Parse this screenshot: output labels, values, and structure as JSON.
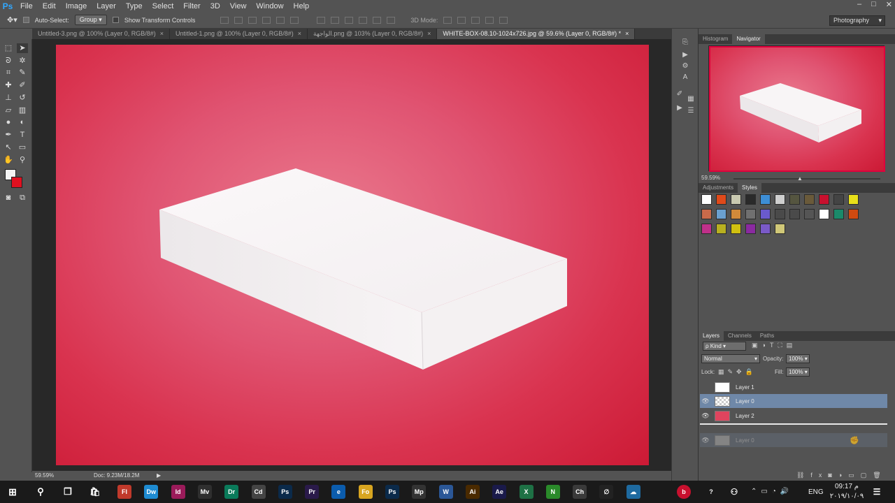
{
  "app": {
    "logo": "Ps"
  },
  "menu": [
    "File",
    "Edit",
    "Image",
    "Layer",
    "Type",
    "Select",
    "Filter",
    "3D",
    "View",
    "Window",
    "Help"
  ],
  "window_controls": [
    "–",
    "□",
    "✕"
  ],
  "options_bar": {
    "auto_select_label": "Auto-Select:",
    "auto_select_value": "Group",
    "show_transform_label": "Show Transform Controls",
    "mode_3d_label": "3D Mode:"
  },
  "workspace": "Photography",
  "tabs": [
    {
      "label": "Untitled-3.png @ 100% (Layer 0, RGB/8#)",
      "close": "×"
    },
    {
      "label": "Untitled-1.png @ 100% (Layer 0, RGB/8#)",
      "close": "×"
    },
    {
      "label": "الواجهة.png @ 103% (Layer 0, RGB/8#)",
      "close": "×"
    },
    {
      "label": "WHITE-BOX-08.10-1024x726.jpg @ 59.6% (Layer 0, RGB/8#) *",
      "close": "×"
    }
  ],
  "status": {
    "zoom": "59.59%",
    "doc": "Doc: 9.23M/18.2M"
  },
  "navigator": {
    "tabs": [
      "Histogram",
      "Navigator"
    ],
    "zoom": "59.59%"
  },
  "styles_panel": {
    "tabs": [
      "Adjustments",
      "Styles"
    ],
    "swatch_colors": [
      "#ffffff",
      "#e04a1a",
      "#c9c9b0",
      "#2a2a2a",
      "#3d8ed6",
      "#cfcfcf",
      "#555540",
      "#6a5a3a",
      "#c8102e",
      "#444",
      "#e8e01a",
      "#c86a4a",
      "#6aa0d0",
      "#d08a3a",
      "#707070",
      "#6a5acd",
      "#4a4a4a",
      "#4a4a4a",
      "#555",
      "#ffffff",
      "#1a8a6a",
      "#d04a10",
      "#c0308a",
      "#b8b020",
      "#d0c010",
      "#8a2aa0",
      "#7a5ac8",
      "#d0c878"
    ]
  },
  "layers_panel": {
    "tabs": [
      "Layers",
      "Channels",
      "Paths"
    ],
    "kind": "ρ Kind",
    "blend_mode": "Normal",
    "opacity_label": "Opacity:",
    "opacity": "100%",
    "lock_label": "Lock:",
    "fill_label": "Fill:",
    "fill": "100%",
    "layers": [
      {
        "name": "Layer 1",
        "visible": false
      },
      {
        "name": "Layer 0",
        "visible": true,
        "selected": true
      },
      {
        "name": "Layer 2",
        "visible": true
      }
    ],
    "drag_ghost": "Layer 0"
  },
  "taskbar": {
    "lang": "ENG",
    "time": "09:17 م",
    "date": "٢٠١٩/١٠/٠٩",
    "apps": [
      {
        "label": "Fl",
        "color": "#c0392b"
      },
      {
        "label": "Dw",
        "color": "#1e8bd1"
      },
      {
        "label": "Id",
        "color": "#9b1b5a"
      },
      {
        "label": "Mv",
        "color": "#2f2f2f"
      },
      {
        "label": "Dr",
        "color": "#0a7a5a"
      },
      {
        "label": "Cd",
        "color": "#444"
      },
      {
        "label": "Ps",
        "color": "#0b2a4a"
      },
      {
        "label": "Pr",
        "color": "#2a1a4a"
      },
      {
        "label": "e",
        "color": "#0b5cad"
      },
      {
        "label": "Fo",
        "color": "#d8a520"
      },
      {
        "label": "Ps",
        "color": "#0b2a4a"
      },
      {
        "label": "Mp",
        "color": "#333"
      },
      {
        "label": "W",
        "color": "#2b5797"
      },
      {
        "label": "Ai",
        "color": "#4a2a00"
      },
      {
        "label": "Ae",
        "color": "#1a1a4a"
      },
      {
        "label": "X",
        "color": "#1e7145"
      },
      {
        "label": "N",
        "color": "#2a8a2a"
      },
      {
        "label": "Ch",
        "color": "#3a3a3a"
      },
      {
        "label": "∅",
        "color": "#222"
      },
      {
        "label": "☁",
        "color": "#1e6aa0"
      }
    ]
  }
}
